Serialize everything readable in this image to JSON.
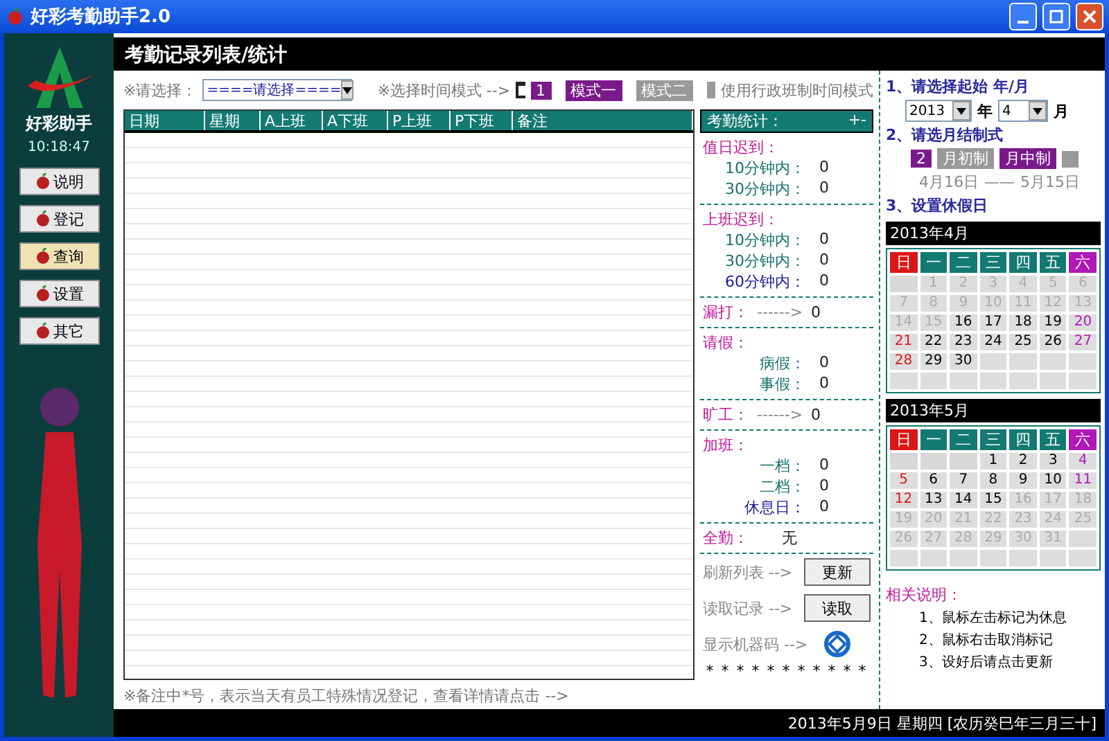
{
  "window": {
    "title": "好彩考勤助手2.0"
  },
  "sidebar": {
    "logo_text": "好彩助手",
    "time": "10:18:47",
    "buttons": [
      {
        "label": "说明",
        "selected": false
      },
      {
        "label": "登记",
        "selected": false
      },
      {
        "label": "查询",
        "selected": true
      },
      {
        "label": "设置",
        "selected": false
      },
      {
        "label": "其它",
        "selected": false
      }
    ]
  },
  "header": {
    "title": "考勤记录列表/统计"
  },
  "toolbar": {
    "select_label": "※请选择：",
    "select_value": "====请选择====",
    "mode_label": "※选择时间模式 -->",
    "mode_number": "1",
    "modes": [
      {
        "label": "模式一",
        "selected": true
      },
      {
        "label": "模式二",
        "selected": false
      }
    ],
    "admin_mode": {
      "label": "使用行政班制时间模式",
      "checked": false
    }
  },
  "table": {
    "columns": [
      "日期",
      "星期",
      "A上班",
      "A下班",
      "P上班",
      "P下班",
      "备注"
    ]
  },
  "stats": {
    "title": "考勤统计：",
    "toggle": "+-",
    "sections": [
      {
        "kind": "list",
        "title": "值日迟到：",
        "items": [
          {
            "label": "10分钟内：",
            "value": "0"
          },
          {
            "label": "30分钟内：",
            "value": "0"
          }
        ]
      },
      {
        "kind": "list",
        "title": "上班迟到：",
        "items": [
          {
            "label": "10分钟内：",
            "value": "0"
          },
          {
            "label": "30分钟内：",
            "value": "0"
          },
          {
            "label": "60分钟内：",
            "value": "0"
          }
        ]
      },
      {
        "kind": "arrow",
        "title": "漏打：",
        "arrow": "------>",
        "value": "0"
      },
      {
        "kind": "list",
        "title": "请假：",
        "items": [
          {
            "label": "病假：",
            "value": "0"
          },
          {
            "label": "事假：",
            "value": "0"
          }
        ]
      },
      {
        "kind": "arrow",
        "title": "旷工：",
        "arrow": "------>",
        "value": "0"
      },
      {
        "kind": "list",
        "title": "加班：",
        "items": [
          {
            "label": "一档：",
            "value": "0"
          },
          {
            "label": "二档：",
            "value": "0"
          },
          {
            "label": "休息日：",
            "value": "0"
          }
        ]
      },
      {
        "kind": "inline",
        "title": "全勤：",
        "value": "无"
      }
    ],
    "actions": [
      {
        "kind": "button",
        "label": "刷新列表 -->",
        "button": "更新"
      },
      {
        "kind": "button",
        "label": "读取记录 -->",
        "button": "读取"
      },
      {
        "kind": "icon",
        "label": "显示机器码 -->"
      }
    ],
    "stars": "* * * * * * * * * * *"
  },
  "hint": "※备注中*号，表示当天有员工特殊情况登记，查看详情请点击 -->",
  "right": {
    "step1": "1、请选择起始 年/月",
    "year": "2013",
    "year_unit": "年",
    "month": "4",
    "month_unit": "月",
    "step2": "2、请选月结制式",
    "period_number": "2",
    "periods": [
      {
        "label": "月初制",
        "selected": false
      },
      {
        "label": "月中制",
        "selected": true
      }
    ],
    "range_start": "4月16日",
    "range_sep": "——",
    "range_end": "5月15日",
    "step3": "3、设置休假日",
    "calendars": [
      {
        "title": "2013年4月",
        "weekdays": [
          "日",
          "一",
          "二",
          "三",
          "四",
          "五",
          "六"
        ],
        "days": [
          {
            "kind": "blank"
          },
          {
            "day": "1",
            "active": false
          },
          {
            "day": "2",
            "active": false
          },
          {
            "day": "3",
            "active": false
          },
          {
            "day": "4",
            "active": false
          },
          {
            "day": "5",
            "active": false
          },
          {
            "day": "6",
            "active": false
          },
          {
            "day": "7",
            "active": false
          },
          {
            "day": "8",
            "active": false
          },
          {
            "day": "9",
            "active": false
          },
          {
            "day": "10",
            "active": false
          },
          {
            "day": "11",
            "active": false
          },
          {
            "day": "12",
            "active": false
          },
          {
            "day": "13",
            "active": false
          },
          {
            "day": "14",
            "active": false
          },
          {
            "day": "15",
            "active": false
          },
          {
            "day": "16",
            "active": true
          },
          {
            "day": "17",
            "active": true
          },
          {
            "day": "18",
            "active": true
          },
          {
            "day": "19",
            "active": true
          },
          {
            "day": "20",
            "active": true
          },
          {
            "day": "21",
            "active": true
          },
          {
            "day": "22",
            "active": true
          },
          {
            "day": "23",
            "active": true
          },
          {
            "day": "24",
            "active": true
          },
          {
            "day": "25",
            "active": true
          },
          {
            "day": "26",
            "active": true
          },
          {
            "day": "27",
            "active": true
          },
          {
            "day": "28",
            "active": true
          },
          {
            "day": "29",
            "active": true
          },
          {
            "day": "30",
            "active": true
          }
        ]
      },
      {
        "title": "2013年5月",
        "weekdays": [
          "日",
          "一",
          "二",
          "三",
          "四",
          "五",
          "六"
        ],
        "days": [
          {
            "kind": "blank"
          },
          {
            "kind": "blank"
          },
          {
            "kind": "blank"
          },
          {
            "day": "1",
            "active": true
          },
          {
            "day": "2",
            "active": true
          },
          {
            "day": "3",
            "active": true
          },
          {
            "day": "4",
            "active": true
          },
          {
            "day": "5",
            "active": true
          },
          {
            "day": "6",
            "active": true
          },
          {
            "day": "7",
            "active": true
          },
          {
            "day": "8",
            "active": true
          },
          {
            "day": "9",
            "active": true
          },
          {
            "day": "10",
            "active": true
          },
          {
            "day": "11",
            "active": true
          },
          {
            "day": "12",
            "active": true
          },
          {
            "day": "13",
            "active": true
          },
          {
            "day": "14",
            "active": true
          },
          {
            "day": "15",
            "active": true
          },
          {
            "day": "16",
            "active": false
          },
          {
            "day": "17",
            "active": false
          },
          {
            "day": "18",
            "active": false
          },
          {
            "day": "19",
            "active": false
          },
          {
            "day": "20",
            "active": false
          },
          {
            "day": "21",
            "active": false
          },
          {
            "day": "22",
            "active": false
          },
          {
            "day": "23",
            "active": false
          },
          {
            "day": "24",
            "active": false
          },
          {
            "day": "25",
            "active": false
          },
          {
            "day": "26",
            "active": false
          },
          {
            "day": "27",
            "active": false
          },
          {
            "day": "28",
            "active": false
          },
          {
            "day": "29",
            "active": false
          },
          {
            "day": "30",
            "active": false
          },
          {
            "day": "31",
            "active": false
          }
        ]
      }
    ],
    "notes_title": "相关说明：",
    "notes": [
      "1、鼠标左击标记为休息",
      "2、鼠标右击取消标记",
      "3、设好后请点击更新"
    ]
  },
  "status_bar": {
    "date": "2013年5月9日 星期四 [农历癸巳年三月三十]"
  }
}
